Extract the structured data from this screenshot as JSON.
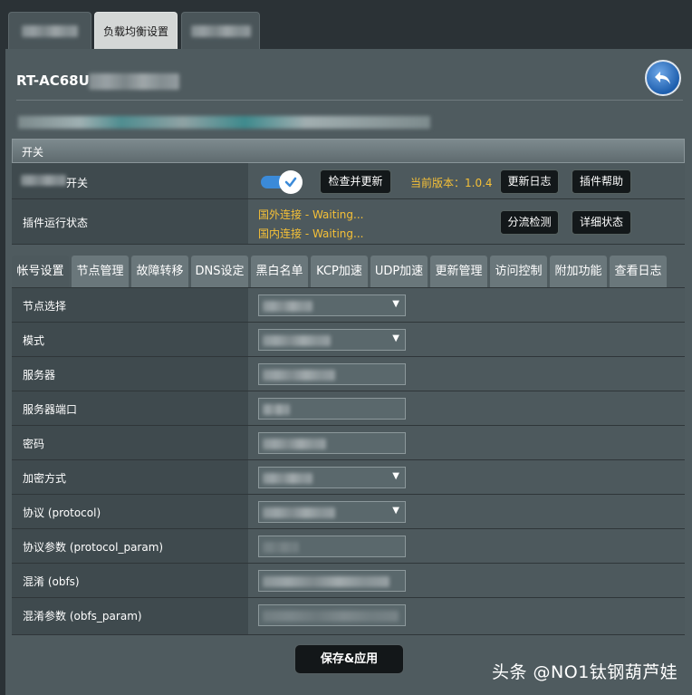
{
  "top_tabs": [
    "",
    "负载均衡设置",
    ""
  ],
  "header": {
    "title": "RT-AC68U"
  },
  "switch_section": {
    "title": "开关",
    "toggle_label": "开关",
    "check_update_label": "检查并更新",
    "version_text": "当前版本：1.0.4",
    "changelog_label": "更新日志",
    "help_label": "插件帮助",
    "status_label": "插件运行状态",
    "foreign_status": "国外连接 - Waiting...",
    "domestic_status": "国内连接 - Waiting...",
    "split_check_label": "分流检测",
    "detail_status_label": "详细状态"
  },
  "sub_tabs": [
    "帐号设置",
    "节点管理",
    "故障转移",
    "DNS设定",
    "黑白名单",
    "KCP加速",
    "UDP加速",
    "更新管理",
    "访问控制",
    "附加功能",
    "查看日志"
  ],
  "form": {
    "rows": [
      "节点选择",
      "模式",
      "服务器",
      "服务器端口",
      "密码",
      "加密方式",
      "协议 (protocol)",
      "协议参数 (protocol_param)",
      "混淆 (obfs)",
      "混淆参数 (obfs_param)"
    ]
  },
  "save_label": "保存&应用",
  "watermark": "头条 @NO1钛钢葫芦娃",
  "colors": {
    "accent": "#3b8ad8",
    "warning_text": "#f5c037"
  }
}
